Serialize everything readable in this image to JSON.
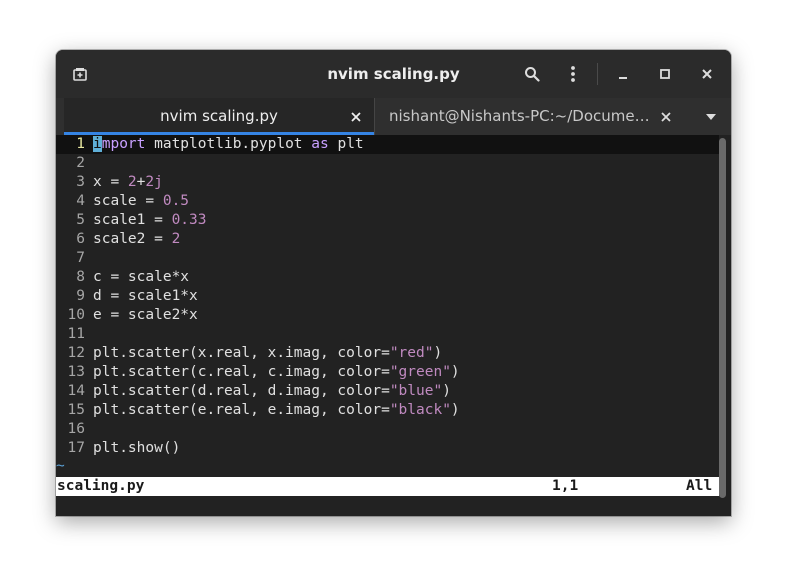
{
  "window": {
    "title": "nvim scaling.py",
    "icons": {
      "new_tab": "new-tab-icon",
      "search": "search-icon",
      "menu": "kebab-menu-icon",
      "minimize": "minimize-icon",
      "maximize": "maximize-icon",
      "close": "close-icon"
    }
  },
  "tabs": [
    {
      "label": "nvim scaling.py",
      "active": true
    },
    {
      "label": "nishant@Nishants-PC:~/Documents",
      "active": false
    }
  ],
  "editor": {
    "lines": [
      {
        "n": "1",
        "segments": [
          {
            "t": "i",
            "c": "cursor"
          },
          {
            "t": "mport",
            "c": "kw"
          },
          {
            "t": " matplotlib.pyplot ",
            "c": ""
          },
          {
            "t": "as",
            "c": "kw"
          },
          {
            "t": " plt",
            "c": ""
          }
        ]
      },
      {
        "n": "2",
        "segments": []
      },
      {
        "n": "3",
        "segments": [
          {
            "t": "x = ",
            "c": ""
          },
          {
            "t": "2",
            "c": "num"
          },
          {
            "t": "+",
            "c": ""
          },
          {
            "t": "2j",
            "c": "num"
          }
        ]
      },
      {
        "n": "4",
        "segments": [
          {
            "t": "scale = ",
            "c": ""
          },
          {
            "t": "0.5",
            "c": "num"
          }
        ]
      },
      {
        "n": "5",
        "segments": [
          {
            "t": "scale1 = ",
            "c": ""
          },
          {
            "t": "0.33",
            "c": "num"
          }
        ]
      },
      {
        "n": "6",
        "segments": [
          {
            "t": "scale2 = ",
            "c": ""
          },
          {
            "t": "2",
            "c": "num"
          }
        ]
      },
      {
        "n": "7",
        "segments": []
      },
      {
        "n": "8",
        "segments": [
          {
            "t": "c = scale*x",
            "c": ""
          }
        ]
      },
      {
        "n": "9",
        "segments": [
          {
            "t": "d = scale1*x",
            "c": ""
          }
        ]
      },
      {
        "n": "10",
        "segments": [
          {
            "t": "e = scale2*x",
            "c": ""
          }
        ]
      },
      {
        "n": "11",
        "segments": []
      },
      {
        "n": "12",
        "segments": [
          {
            "t": "plt.scatter(x.real, x.imag, color=",
            "c": ""
          },
          {
            "t": "\"red\"",
            "c": "str"
          },
          {
            "t": ")",
            "c": ""
          }
        ]
      },
      {
        "n": "13",
        "segments": [
          {
            "t": "plt.scatter(c.real, c.imag, color=",
            "c": ""
          },
          {
            "t": "\"green\"",
            "c": "str"
          },
          {
            "t": ")",
            "c": ""
          }
        ]
      },
      {
        "n": "14",
        "segments": [
          {
            "t": "plt.scatter(d.real, d.imag, color=",
            "c": ""
          },
          {
            "t": "\"blue\"",
            "c": "str"
          },
          {
            "t": ")",
            "c": ""
          }
        ]
      },
      {
        "n": "15",
        "segments": [
          {
            "t": "plt.scatter(e.real, e.imag, color=",
            "c": ""
          },
          {
            "t": "\"black\"",
            "c": "str"
          },
          {
            "t": ")",
            "c": ""
          }
        ]
      },
      {
        "n": "16",
        "segments": []
      },
      {
        "n": "17",
        "segments": [
          {
            "t": "plt.show()",
            "c": ""
          }
        ]
      }
    ],
    "tilde": "~",
    "status": {
      "filename": "scaling.py",
      "position": "1,1",
      "scroll": "All"
    }
  },
  "colors": {
    "accent": "#3584e4",
    "cursor": "#5fafd7",
    "literal": "#c08ac0",
    "keyword": "#c8a0ff"
  }
}
